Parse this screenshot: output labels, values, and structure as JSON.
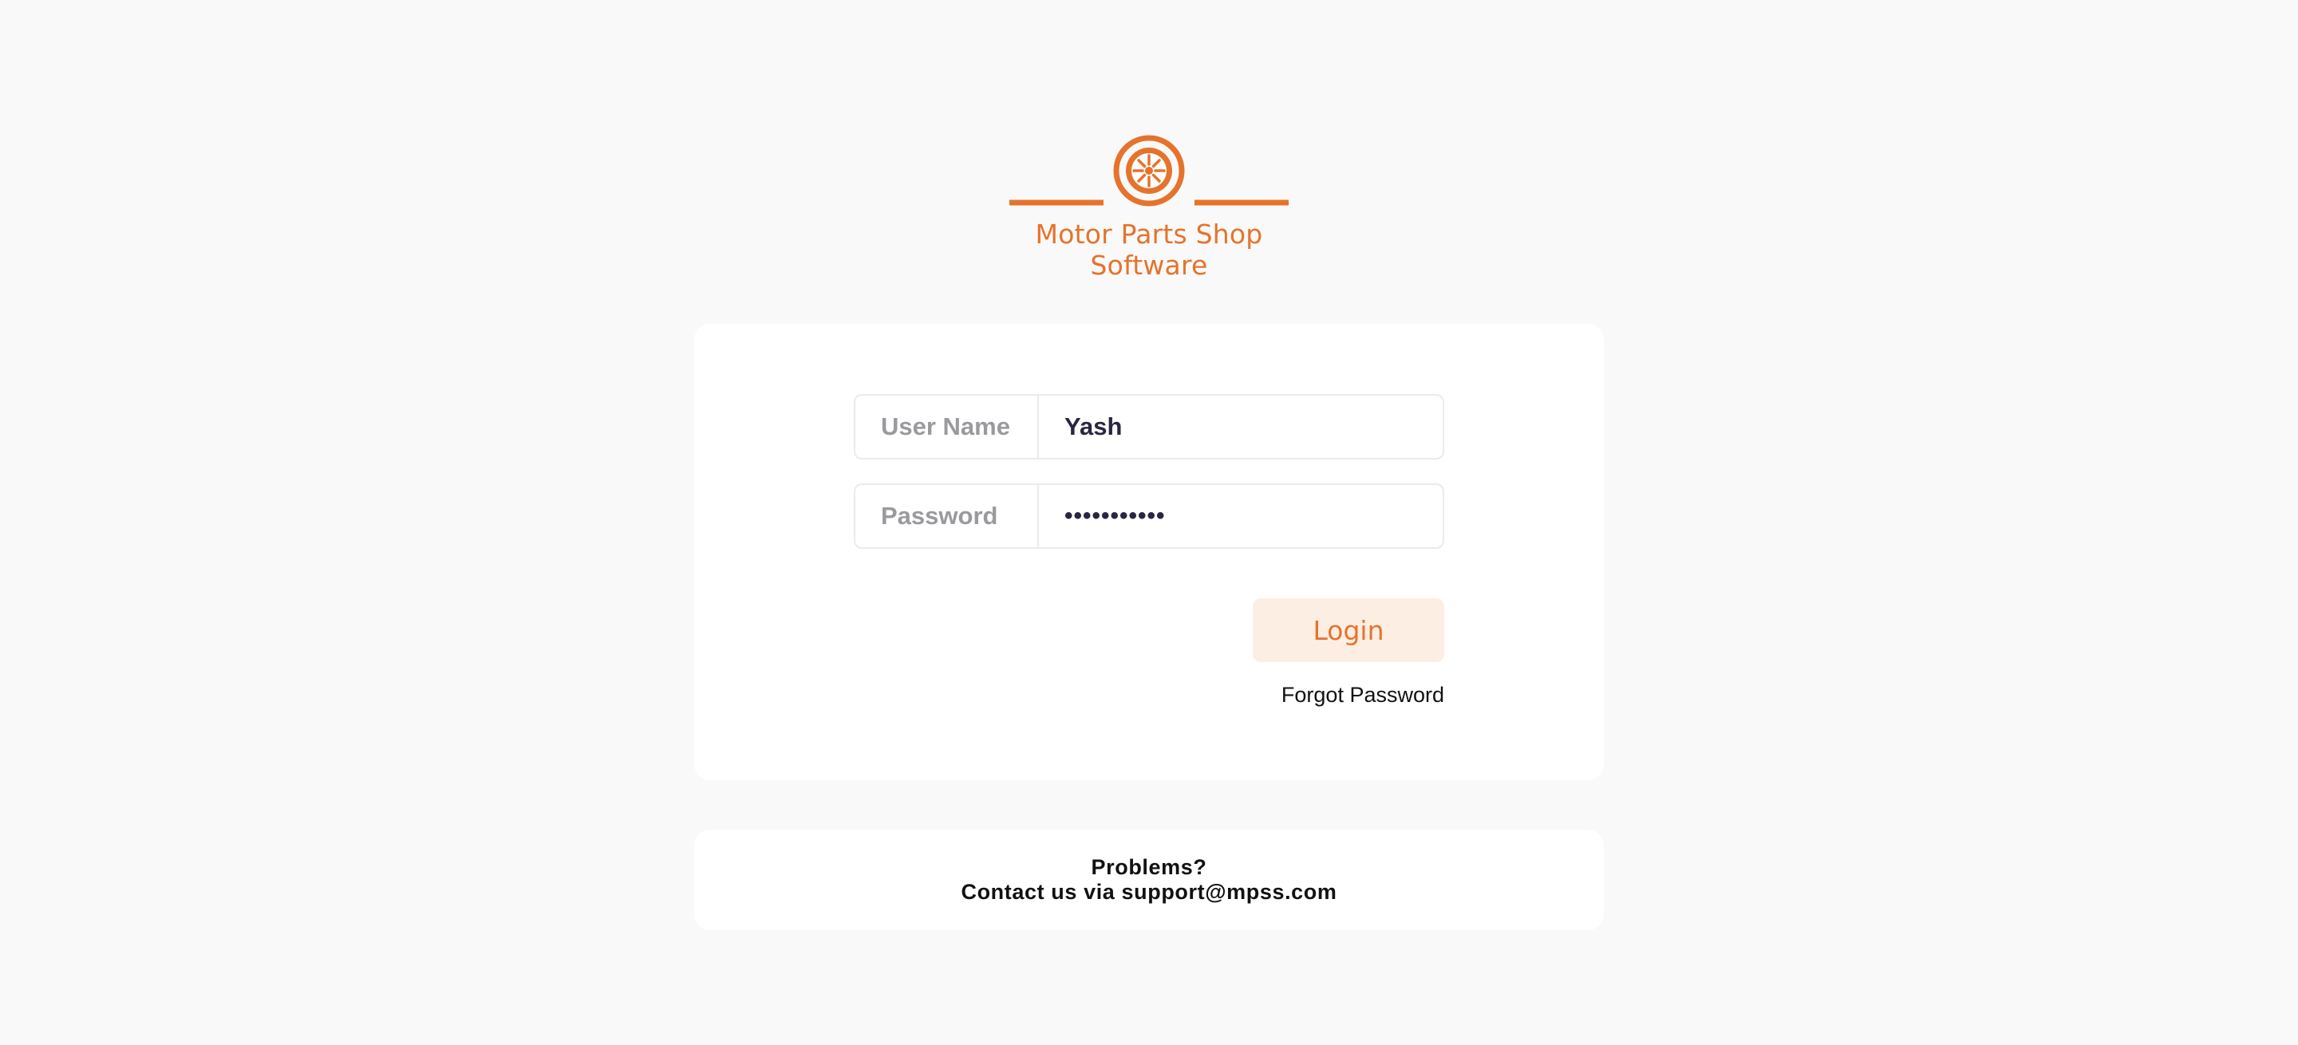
{
  "brand": {
    "name": "Motor Parts Shop Software",
    "logo_icon": "wheel-icon",
    "accent_color": "#e6732b"
  },
  "login_form": {
    "username_label": "User Name",
    "username_value": "Yash",
    "password_label": "Password",
    "password_value": "•••••••••••",
    "login_label": "Login",
    "forgot_label": "Forgot Password"
  },
  "help": {
    "line1": "Problems?",
    "line2_prefix": "Contact us via ",
    "email": "support@mpss.com"
  }
}
